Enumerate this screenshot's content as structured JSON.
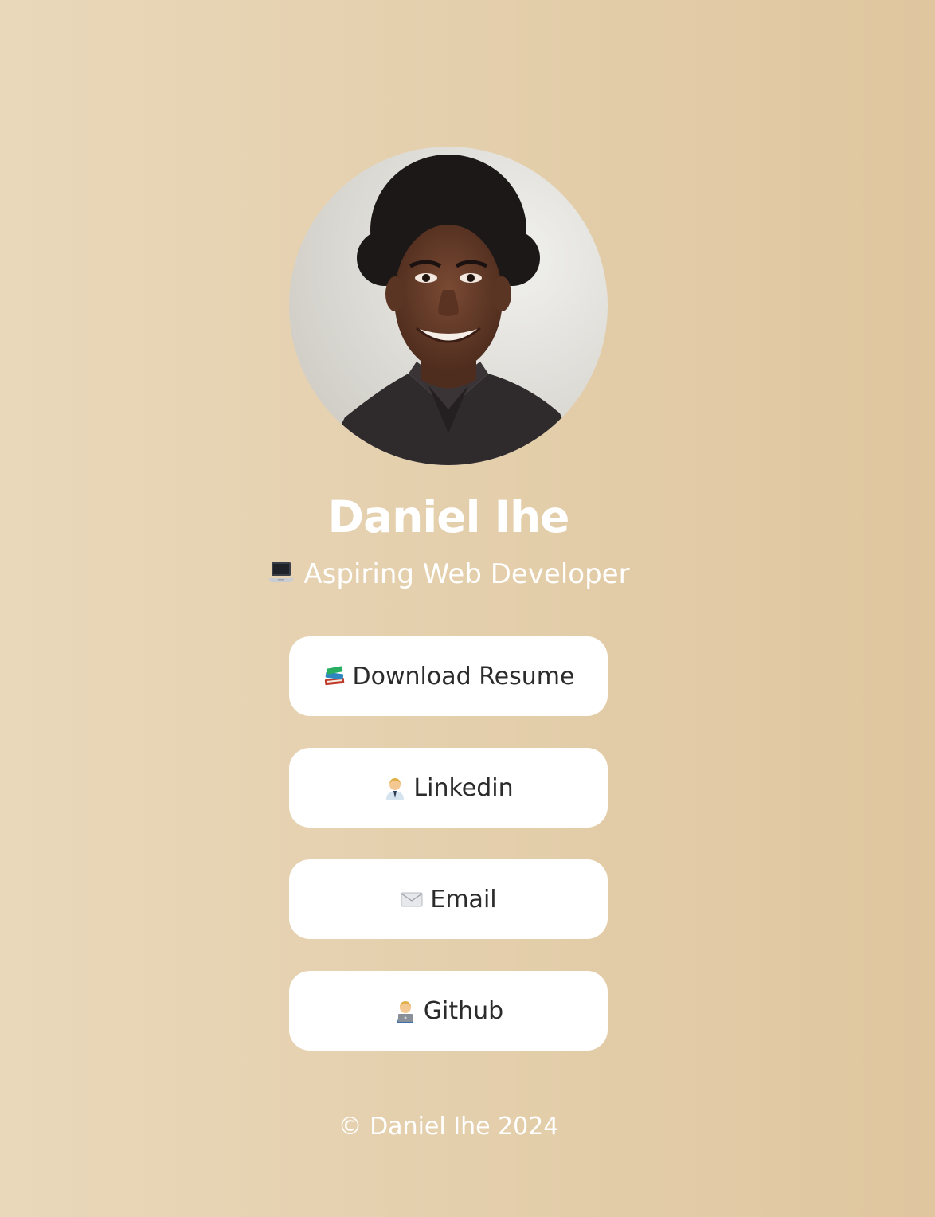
{
  "profile": {
    "photo_alt": "Profile photo",
    "name": "Daniel Ihe",
    "tagline_icon": "laptop-icon",
    "tagline": "Aspiring Web Developer"
  },
  "links": [
    {
      "icon": "books-icon",
      "label": "Download Resume"
    },
    {
      "icon": "office-worker-icon",
      "label": "Linkedin"
    },
    {
      "icon": "envelope-icon",
      "label": "Email"
    },
    {
      "icon": "technologist-icon",
      "label": "Github"
    }
  ],
  "footer": {
    "text": "© Daniel Ihe 2024"
  },
  "colors": {
    "background_start": "#e9d8ba",
    "background_end": "#dfc69f",
    "button_background": "#ffffff",
    "button_text": "#2b2b2b",
    "light_text": "#ffffff"
  }
}
